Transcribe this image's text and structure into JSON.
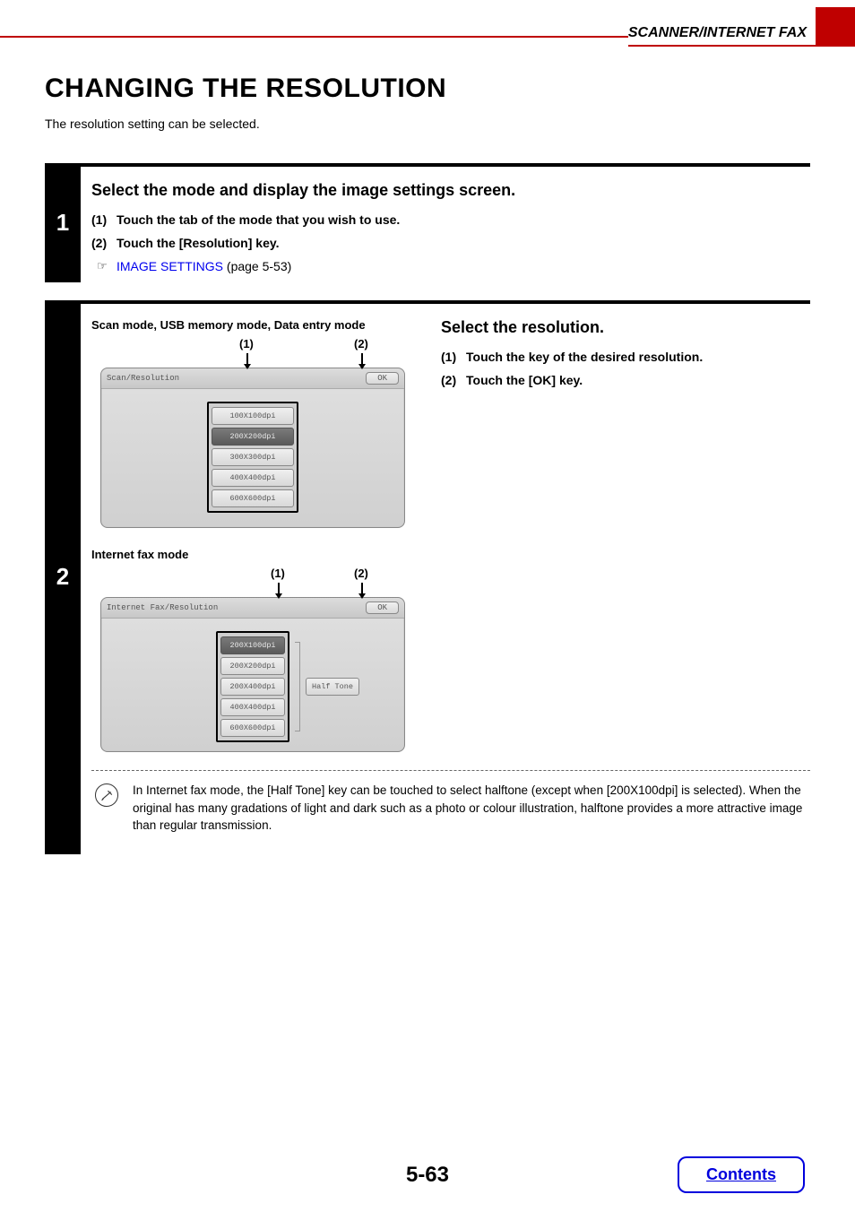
{
  "header": {
    "section": "SCANNER/INTERNET FAX"
  },
  "title": "CHANGING THE RESOLUTION",
  "intro": "The resolution setting can be selected.",
  "step1": {
    "num": "1",
    "title": "Select the mode and display the image settings screen.",
    "subs": [
      {
        "n": "(1)",
        "text": "Touch the tab of the mode that you wish to use."
      },
      {
        "n": "(2)",
        "text": "Touch the [Resolution] key."
      }
    ],
    "xref_symbol": "☞",
    "xref_link": "IMAGE SETTINGS",
    "xref_tail": " (page 5-53)"
  },
  "step2": {
    "num": "2",
    "mode_label_1": "Scan mode, USB memory mode, Data entry mode",
    "callout1": "(1)",
    "callout2": "(2)",
    "panel1_title": "Scan/Resolution",
    "ok_label": "OK",
    "panel1_options": [
      "100X100dpi",
      "200X200dpi",
      "300X300dpi",
      "400X400dpi",
      "600X600dpi"
    ],
    "panel1_selected": 1,
    "mode_label_2": "Internet fax mode",
    "panel2_title": "Internet Fax/Resolution",
    "panel2_options": [
      "200X100dpi",
      "200X200dpi",
      "200X400dpi",
      "400X400dpi",
      "600X600dpi"
    ],
    "panel2_selected": 0,
    "halftone": "Half Tone",
    "right_title": "Select the resolution.",
    "right_subs": [
      {
        "n": "(1)",
        "text": "Touch the key of the desired resolution."
      },
      {
        "n": "(2)",
        "text": "Touch the [OK] key."
      }
    ],
    "note": "In Internet fax mode, the [Half Tone] key can be touched to select halftone (except when [200X100dpi] is selected). When the original has many gradations of light and dark such as a photo or colour illustration, halftone provides a more attractive image than regular transmission."
  },
  "footer": {
    "page": "5-63",
    "contents": "Contents"
  }
}
